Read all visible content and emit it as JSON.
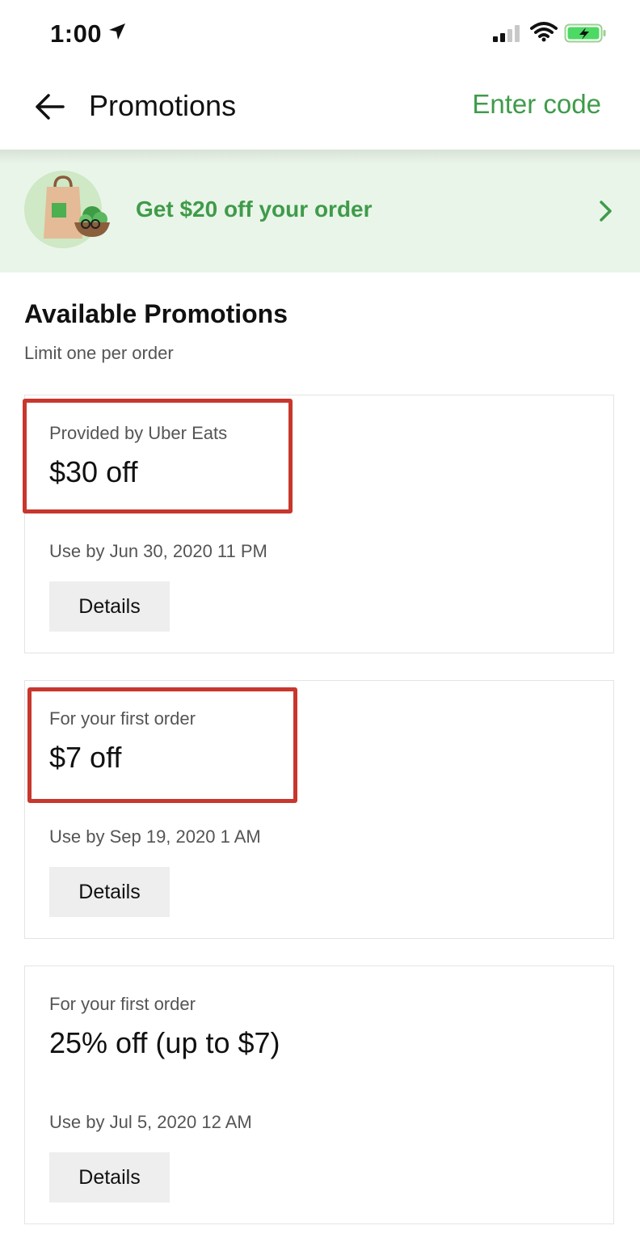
{
  "status_bar": {
    "time": "1:00",
    "location_icon": "location-arrow-icon",
    "signal_icon": "cellular-signal-icon",
    "wifi_icon": "wifi-icon",
    "battery_icon": "battery-charging-icon"
  },
  "header": {
    "back_icon": "back-arrow-icon",
    "title": "Promotions",
    "enter_code_label": "Enter code"
  },
  "banner": {
    "text": "Get $20 off your order",
    "chevron_icon": "chevron-right-icon",
    "illustration": "grocery-bag-illustration"
  },
  "section": {
    "title": "Available Promotions",
    "subtitle": "Limit one per order"
  },
  "promotions": [
    {
      "provider": "Provided by Uber Eats",
      "amount": "$30 off",
      "expiry": "Use by Jun 30, 2020 11 PM",
      "details_label": "Details",
      "highlighted": true
    },
    {
      "provider": "For your first order",
      "amount": "$7 off",
      "expiry": "Use by Sep 19, 2020 1 AM",
      "details_label": "Details",
      "highlighted": true
    },
    {
      "provider": "For your first order",
      "amount": "25% off (up to $7)",
      "expiry": "Use by Jul 5, 2020 12 AM",
      "details_label": "Details",
      "highlighted": false
    }
  ],
  "colors": {
    "accent_green": "#3f9b4a",
    "banner_background": "#eaf5e9",
    "highlight_red": "#c8372d",
    "button_gray": "#eeeeee"
  }
}
